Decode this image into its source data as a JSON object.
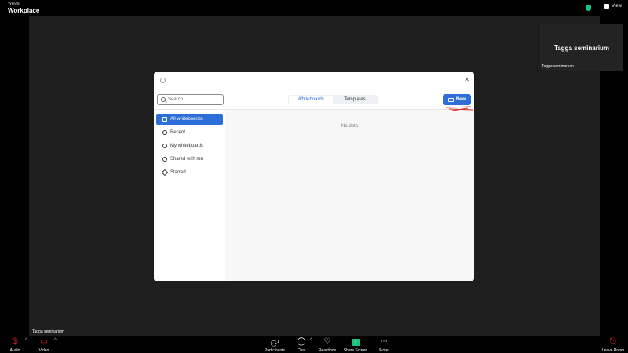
{
  "brand": {
    "top": "zoom",
    "bottom": "Workplace"
  },
  "header": {
    "view_label": "View"
  },
  "main_video": {
    "participant_name": "Tagga seminarium"
  },
  "self_view": {
    "display_name": "Tagga seminarium",
    "name_tag": "Tagga seminarium"
  },
  "whiteboard": {
    "search_placeholder": "Search",
    "tabs": [
      {
        "label": "Whiteboards",
        "active": true
      },
      {
        "label": "Templates",
        "active": false
      }
    ],
    "new_button_label": "New",
    "sidebar": [
      {
        "label": "All whiteboards",
        "icon": "folder-icon",
        "active": true
      },
      {
        "label": "Recent",
        "icon": "clock-icon",
        "active": false
      },
      {
        "label": "My whiteboards",
        "icon": "user-icon",
        "active": false
      },
      {
        "label": "Shared with me",
        "icon": "users-icon",
        "active": false
      },
      {
        "label": "Starred",
        "icon": "star-icon",
        "active": false
      }
    ],
    "empty_text": "No data"
  },
  "toolbar": {
    "audio": "Audio",
    "video": "Video",
    "participants": "Participants",
    "participants_count": "1",
    "chat": "Chat",
    "reactions": "Reactions",
    "share_screen": "Share Screen",
    "more": "More",
    "leave_room": "Leave Room"
  },
  "colors": {
    "accent": "#2d6ed8",
    "share_green": "#19c37d",
    "danger": "#e02828"
  }
}
